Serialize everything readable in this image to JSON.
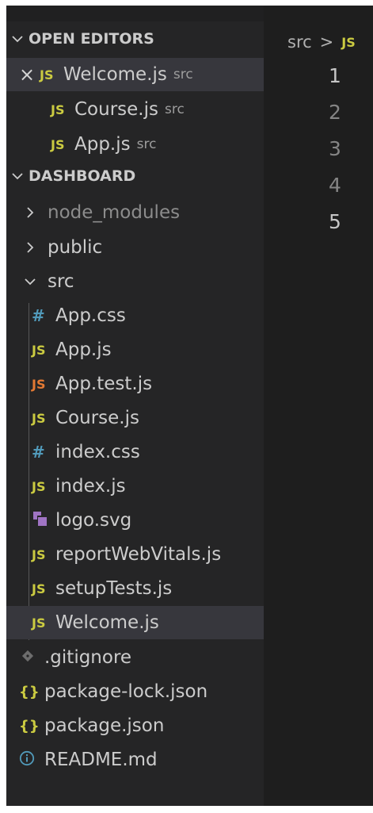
{
  "open_editors": {
    "header": "OPEN EDITORS",
    "items": [
      {
        "name": "Welcome.js",
        "description": "src",
        "icon": "js-icon"
      },
      {
        "name": "Course.js",
        "description": "src",
        "icon": "js-icon"
      },
      {
        "name": "App.js",
        "description": "src",
        "icon": "js-icon"
      }
    ]
  },
  "explorer": {
    "header": "DASHBOARD",
    "folders": [
      {
        "name": "node_modules"
      },
      {
        "name": "public"
      },
      {
        "name": "src"
      }
    ],
    "src_files": [
      {
        "name": "App.css",
        "icon": "hash-icon"
      },
      {
        "name": "App.js",
        "icon": "js-icon"
      },
      {
        "name": "App.test.js",
        "icon": "js-icon"
      },
      {
        "name": "Course.js",
        "icon": "js-icon"
      },
      {
        "name": "index.css",
        "icon": "hash-icon"
      },
      {
        "name": "index.js",
        "icon": "js-icon"
      },
      {
        "name": "logo.svg",
        "icon": "svg-icon"
      },
      {
        "name": "reportWebVitals.js",
        "icon": "js-icon"
      },
      {
        "name": "setupTests.js",
        "icon": "js-icon"
      },
      {
        "name": "Welcome.js",
        "icon": "js-icon"
      }
    ],
    "root_files": [
      {
        "name": ".gitignore",
        "icon": "git-icon"
      },
      {
        "name": "package-lock.json",
        "icon": "braces-icon"
      },
      {
        "name": "package.json",
        "icon": "braces-icon"
      },
      {
        "name": "README.md",
        "icon": "info-icon"
      }
    ]
  },
  "editor": {
    "breadcrumb": {
      "folder": "src",
      "separator": ">",
      "file_icon": "JS"
    },
    "line_numbers": [
      "1",
      "2",
      "3",
      "4",
      "5"
    ]
  },
  "icon_glyphs": {
    "js": "JS",
    "hash": "#",
    "braces": "{}",
    "close": "×"
  },
  "colors": {
    "sidebar_bg": "#252526",
    "editor_bg": "#1e1e1e",
    "selected_bg": "#37373d",
    "js_icon": "#cbcb41",
    "test_icon": "#e37933",
    "css_icon": "#519aba",
    "svg_icon": "#a074c4"
  }
}
